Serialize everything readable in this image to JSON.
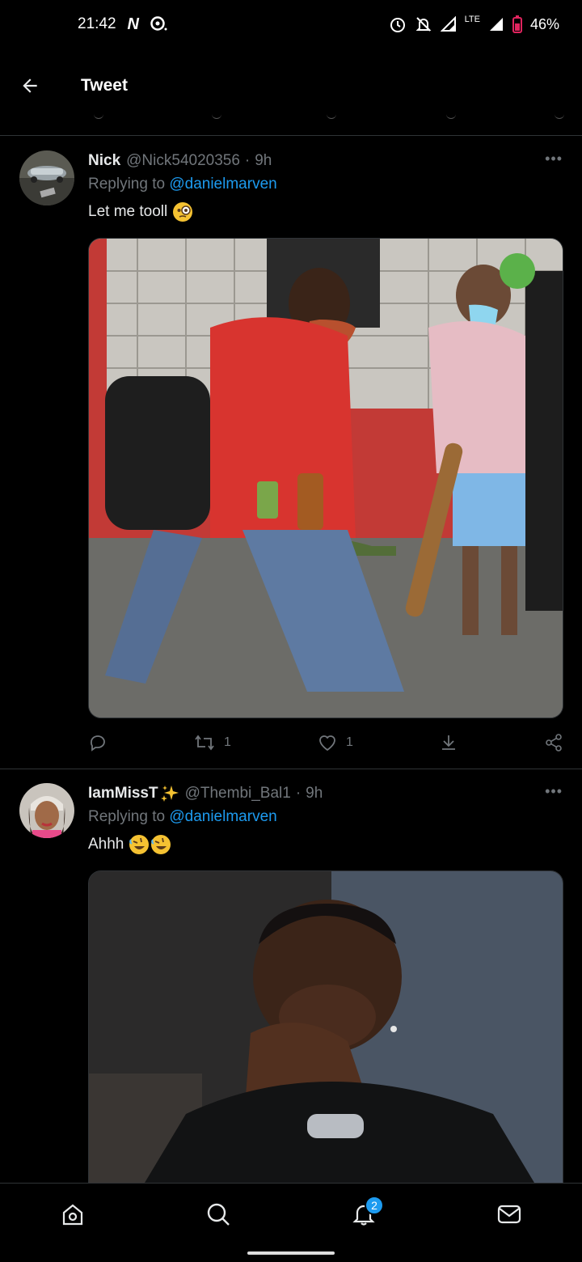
{
  "status_bar": {
    "time": "21:42",
    "network": "LTE",
    "battery": "46%"
  },
  "header": {
    "title": "Tweet"
  },
  "tweets": [
    {
      "display_name": "Nick",
      "handle": "@Nick54020356",
      "separator": "·",
      "time": "9h",
      "replying_prefix": "Replying to",
      "replying_to": "@danielmarven",
      "text": "Let me tooll",
      "emoji": "face-with-monocle",
      "retweets": "1",
      "likes": "1"
    },
    {
      "display_name": "IamMissT",
      "name_emoji": "sparkles",
      "handle": "@Thembi_Bal1",
      "separator": "·",
      "time": "9h",
      "replying_prefix": "Replying to",
      "replying_to": "@danielmarven",
      "text": "Ahhh",
      "emoji": "rolling-on-floor-laughing"
    }
  ],
  "nav": {
    "notifications_badge": "2"
  },
  "colors": {
    "accent": "#1d9bf0",
    "background": "#000000",
    "muted": "#71767b",
    "divider": "#2f3336"
  }
}
